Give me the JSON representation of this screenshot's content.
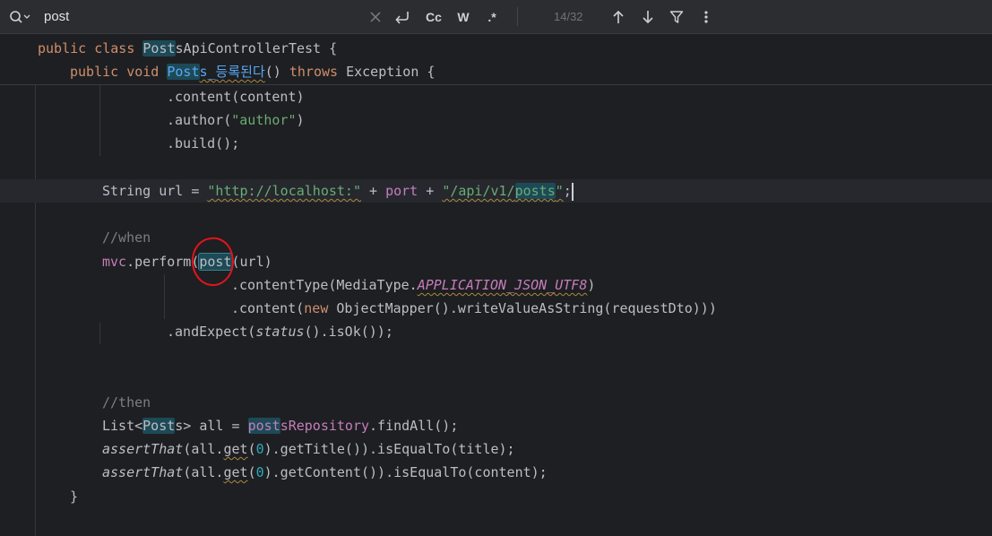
{
  "find_bar": {
    "query": "post",
    "match_counter": "14/32",
    "options": {
      "match_case": "Cc",
      "words": "W",
      "regex": ".*"
    }
  },
  "sticky": {
    "line1": {
      "kw1": "public",
      "kw2": "class",
      "hit": "Post",
      "rest": "sApiControllerTest {"
    },
    "line2": {
      "kw1": "public",
      "kw2": "void",
      "hit": "Post",
      "name_rest": "s_등록된다",
      "paren": "()",
      "kw3": "throws",
      "rest": "Exception {"
    }
  },
  "code": {
    "l_content": ".content(content)",
    "l_author_pre": ".author(",
    "l_author_str": "\"author\"",
    "l_author_post": ")",
    "l_build": ".build();",
    "l_url_type": "String url = ",
    "l_url_str1": "\"http://localhost:\"",
    "l_url_plus1": " + ",
    "l_url_port": "port",
    "l_url_plus2": " + ",
    "l_url_str2_pre": "\"/api/v1/",
    "l_url_str2_hit": "posts",
    "l_url_str2_post": "\"",
    "l_url_semi": ";",
    "l_when": "//when",
    "l_mvc": "mvc",
    "l_perform": ".perform(",
    "l_post_hit": "post",
    "l_post_rest": "(url)",
    "l_ct_pre": ".contentType(MediaType.",
    "l_ct_const": "APPLICATION_JSON_UTF8",
    "l_ct_post": ")",
    "l_c2_pre": ".content(",
    "l_c2_new": "new",
    "l_c2_rest": " ObjectMapper().writeValueAsString(requestDto)))",
    "l_ae_pre": ".andExpect(",
    "l_ae_status": "status",
    "l_ae_rest": "().isOk());",
    "l_then": "//then",
    "l_list_pre": "List<",
    "l_list_hit": "Post",
    "l_list_mid": "s> all = ",
    "l_list_hit2": "post",
    "l_list_field": "sRepository",
    "l_list_rest": ".findAll();",
    "l_a1_fn": "assertThat",
    "l_a1_pre": "(all.",
    "l_a1_get": "get",
    "l_a1_po": "(",
    "l_a1_num": "0",
    "l_a1_rest": ").getTitle()).isEqualTo(title);",
    "l_a2_fn": "assertThat",
    "l_a2_pre": "(all.",
    "l_a2_get": "get",
    "l_a2_po": "(",
    "l_a2_num": "0",
    "l_a2_rest": ").getContent()).isEqualTo(content);",
    "l_close": "}"
  },
  "icons": [
    "search-icon",
    "clear-icon",
    "replace-toggle-icon",
    "arrow-up-icon",
    "arrow-down-icon",
    "filter-icon",
    "more-icon"
  ]
}
